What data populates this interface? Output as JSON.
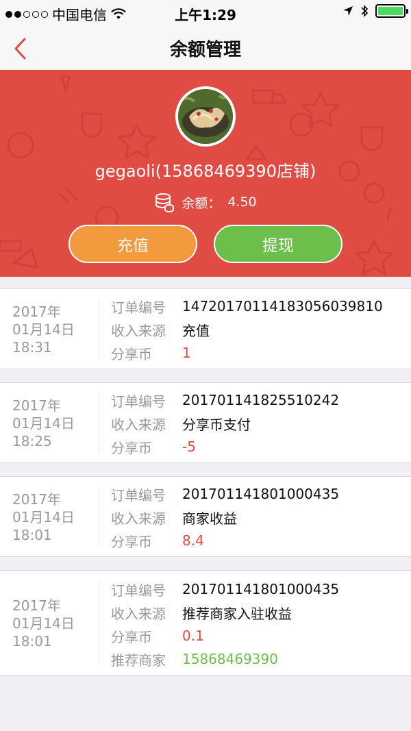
{
  "status_bar": {
    "carrier": "中国电信",
    "time": "上午1:29"
  },
  "nav": {
    "title": "余额管理"
  },
  "profile": {
    "name": "gegaoli(15868469390店铺)",
    "balance_label": "余额：",
    "balance_value": "4.50"
  },
  "actions": {
    "recharge_label": "充值",
    "withdraw_label": "提现"
  },
  "records": [
    {
      "date_year": "2017年",
      "date_day": "01月14日",
      "date_time": "18:31",
      "order_label": "订单编号",
      "order_no": "14720170114183056039810",
      "source_label": "收入来源",
      "source": "充值",
      "coin_label": "分享币",
      "coin": "1"
    },
    {
      "date_year": "2017年",
      "date_day": "01月14日",
      "date_time": "18:25",
      "order_label": "订单编号",
      "order_no": "201701141825510242",
      "source_label": "收入来源",
      "source": "分享币支付",
      "coin_label": "分享币",
      "coin": "-5"
    },
    {
      "date_year": "2017年",
      "date_day": "01月14日",
      "date_time": "18:01",
      "order_label": "订单编号",
      "order_no": "201701141801000435",
      "source_label": "收入来源",
      "source": "商家收益",
      "coin_label": "分享币",
      "coin": "8.4"
    },
    {
      "date_year": "2017年",
      "date_day": "01月14日",
      "date_time": "18:01",
      "order_label": "订单编号",
      "order_no": "201701141801000435",
      "source_label": "收入来源",
      "source": "推荐商家入驻收益",
      "coin_label": "分享币",
      "coin": "0.1",
      "referrer_label": "推荐商家",
      "referrer": "15868469390"
    }
  ],
  "colors": {
    "hero": "#e04c43",
    "recharge": "#f19a3e",
    "withdraw": "#6dbf4c",
    "negative_red": "#e04c43",
    "referrer_green": "#6dbf4c"
  },
  "icons": [
    "back-chevron-icon",
    "coins-icon",
    "wifi-icon",
    "location-arrow-icon",
    "bluetooth-icon",
    "battery-icon"
  ]
}
